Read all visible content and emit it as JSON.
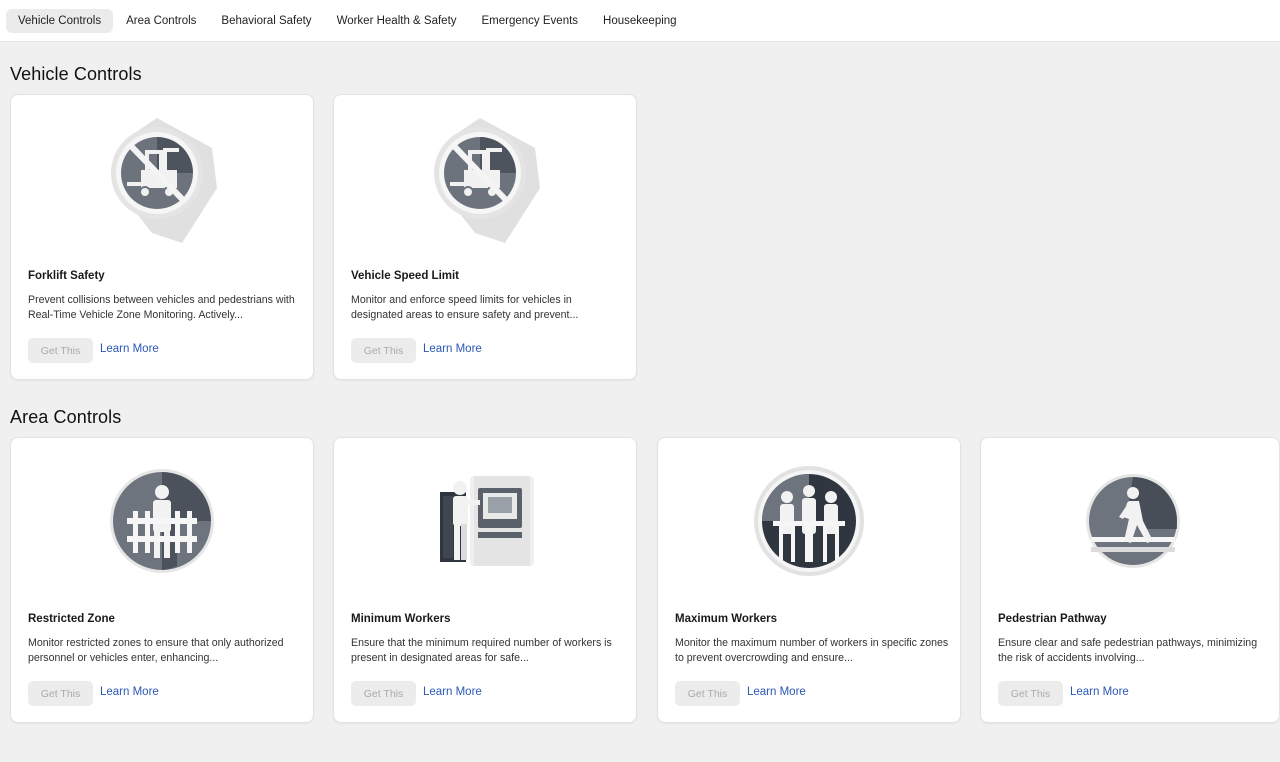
{
  "tabs": [
    {
      "label": "Vehicle Controls",
      "active": true
    },
    {
      "label": "Area Controls",
      "active": false
    },
    {
      "label": "Behavioral Safety",
      "active": false
    },
    {
      "label": "Worker Health & Safety",
      "active": false
    },
    {
      "label": "Emergency Events",
      "active": false
    },
    {
      "label": "Housekeeping",
      "active": false
    }
  ],
  "sections": [
    {
      "title": "Vehicle Controls",
      "cards": [
        {
          "title": "Forklift Safety",
          "description": "Prevent collisions between vehicles and pedestrians with Real-Time Vehicle Zone Monitoring. Actively...",
          "get_label": "Get This",
          "learn_label": "Learn More",
          "icon": "no-forklift-icon"
        },
        {
          "title": "Vehicle Speed Limit",
          "description": "Monitor and enforce speed limits for vehicles in designated areas to ensure safety and prevent...",
          "get_label": "Get This",
          "learn_label": "Learn More",
          "icon": "no-forklift-icon"
        }
      ]
    },
    {
      "title": "Area Controls",
      "cards": [
        {
          "title": "Restricted Zone",
          "description": "Monitor restricted zones to ensure that only authorized personnel or vehicles enter, enhancing...",
          "get_label": "Get This",
          "learn_label": "Learn More",
          "icon": "restricted-zone-icon"
        },
        {
          "title": "Minimum Workers",
          "description": "Ensure that the minimum required number of workers is present in designated areas for safe...",
          "get_label": "Get This",
          "learn_label": "Learn More",
          "icon": "worker-at-terminal-icon"
        },
        {
          "title": "Maximum Workers",
          "description": "Monitor the maximum number of workers in specific zones to prevent overcrowding and ensure...",
          "get_label": "Get This",
          "learn_label": "Learn More",
          "icon": "workers-group-icon"
        },
        {
          "title": "Pedestrian Pathway",
          "description": "Ensure clear and safe pedestrian pathways, minimizing the risk of accidents involving...",
          "get_label": "Get This",
          "learn_label": "Learn More",
          "icon": "pedestrian-walking-icon"
        }
      ]
    }
  ],
  "colors": {
    "page_bg": "#f0f0f0",
    "link": "#2b58b5",
    "icon_dark": "#2f3640",
    "icon_mid": "#6c737d",
    "icon_light": "#e9e9e9"
  }
}
